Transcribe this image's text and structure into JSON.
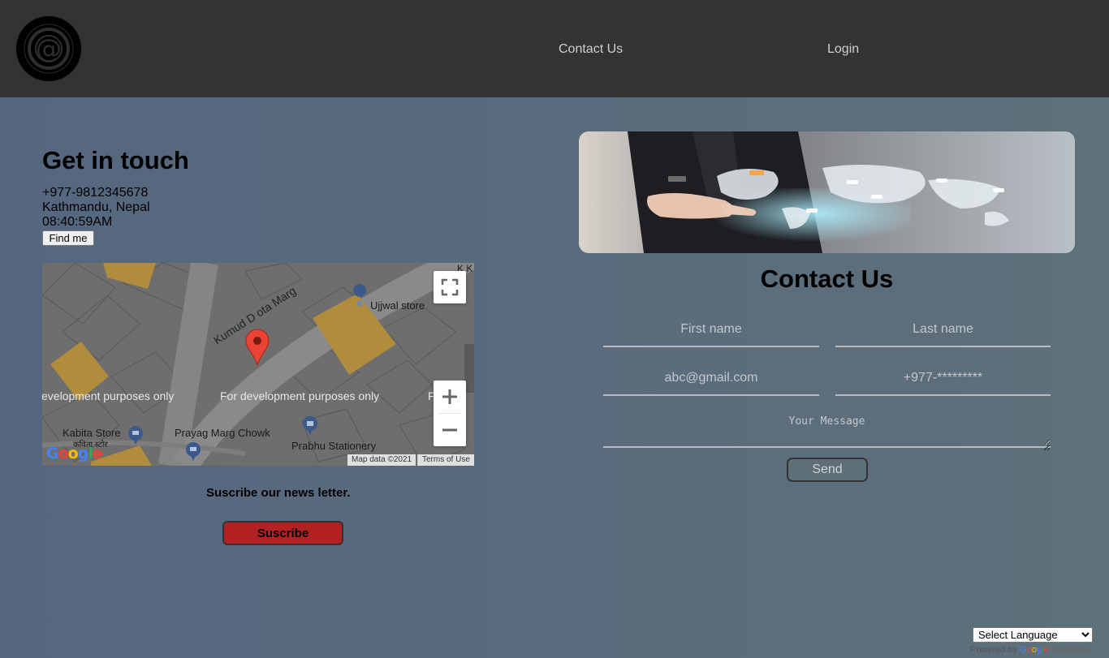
{
  "header": {
    "logo_icon": "at-sign-logo-icon",
    "nav": {
      "contact": "Contact Us",
      "login": "Login"
    }
  },
  "left": {
    "title": "Get in touch",
    "phone": "+977-9812345678",
    "address": "Kathmandu, Nepal",
    "time": "08:40:59AM",
    "find_button": "Find me",
    "map": {
      "street": "Kumud Devkota Marg",
      "street_visible": "Kumud D    ota Marg",
      "place1": "Ujjwal store",
      "place2": "Kabita Store",
      "place2_local": "कविता स्टोर",
      "place3": "Prayag Marg Chowk",
      "place4": "Prabhu Stationery",
      "corner_text": "K K",
      "watermark_left": "evelopment purposes only",
      "watermark_center": "For development purposes only",
      "watermark_right": "F    ve",
      "map_data": "Map data ©2021",
      "terms": "Terms of Use",
      "google": "Google"
    },
    "newsletter_text": "Suscribe our news letter.",
    "subscribe_button": "Suscribe"
  },
  "right": {
    "title": "Contact Us",
    "form": {
      "first_name_placeholder": "First name",
      "last_name_placeholder": "Last name",
      "email_placeholder": "abc@gmail.com",
      "phone_placeholder": "+977-*********",
      "message_placeholder": "Your Message",
      "send_button": "Send"
    }
  },
  "footer": {
    "language_select": "Select Language",
    "powered_by": "Powered by",
    "google": "Google",
    "translate": "Translate"
  },
  "colors": {
    "header_bg": "#333333",
    "subscribe_bg": "#b22222",
    "map_road": "#8e8e8e",
    "map_building": "#b8963a"
  }
}
